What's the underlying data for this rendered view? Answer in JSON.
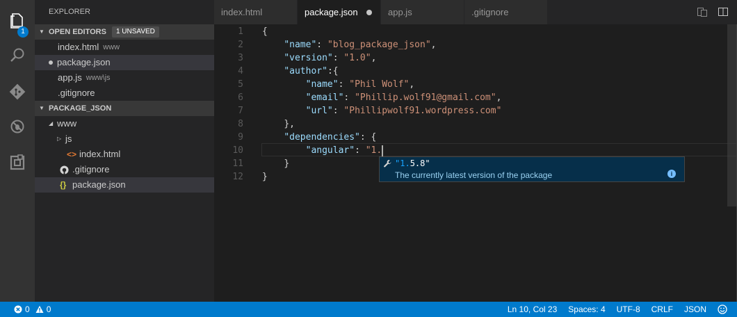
{
  "activity": {
    "explorer_badge": "1"
  },
  "sidebar": {
    "title": "EXPLORER",
    "open_editors": {
      "header": "OPEN EDITORS",
      "badge": "1 UNSAVED",
      "items": [
        {
          "name": "index.html",
          "desc": "www"
        },
        {
          "name": "package.json",
          "desc": ""
        },
        {
          "name": "app.js",
          "desc": "www\\js"
        },
        {
          "name": ".gitignore",
          "desc": ""
        }
      ]
    },
    "project": {
      "header": "PACKAGE_JSON",
      "tree": [
        {
          "name": "www"
        },
        {
          "name": "js"
        },
        {
          "name": "index.html"
        },
        {
          "name": ".gitignore"
        },
        {
          "name": "package.json"
        }
      ]
    }
  },
  "tabs": [
    {
      "label": "index.html"
    },
    {
      "label": "package.json"
    },
    {
      "label": "app.js"
    },
    {
      "label": ".gitignore"
    }
  ],
  "editor": {
    "line_numbers": [
      "1",
      "2",
      "3",
      "4",
      "5",
      "6",
      "7",
      "8",
      "9",
      "10",
      "11",
      "12"
    ],
    "l1": "{",
    "l2_key": "\"name\"",
    "l2_val": "\"blog_package_json\"",
    "l3_key": "\"version\"",
    "l3_val": "\"1.0\"",
    "l4_key": "\"author\"",
    "l5_key": "\"name\"",
    "l5_val": "\"Phil Wolf\"",
    "l6_key": "\"email\"",
    "l6_val": "\"Phillip.wolf91@gmail.com\"",
    "l7_key": "\"url\"",
    "l7_val": "\"Phillipwolf91.wordpress.com\"",
    "l8": "},",
    "l9_key": "\"dependencies\"",
    "l10_key": "\"angular\"",
    "l10_val": "\"1.",
    "l11": "}",
    "l12": "}"
  },
  "suggest": {
    "label_prefix": "\"1.",
    "label_rest": "5.8\"",
    "detail": "The currently latest version of the package",
    "info_glyph": "i"
  },
  "status": {
    "errors": "0",
    "warnings": "0",
    "position": "Ln 10, Col 23",
    "spaces": "Spaces: 4",
    "encoding": "UTF-8",
    "eol": "CRLF",
    "language": "JSON"
  }
}
